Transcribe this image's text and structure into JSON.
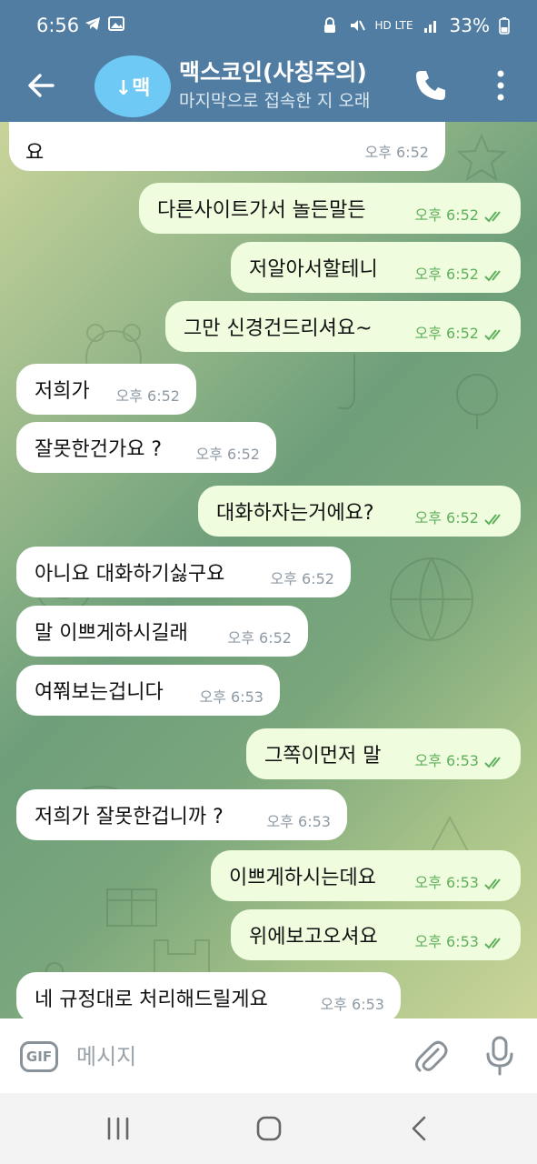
{
  "status_bar": {
    "time": "6:56",
    "network": "HD LTE",
    "battery": "33%"
  },
  "header": {
    "avatar_text": "↓맥",
    "title": "맥스코인(사칭주의)",
    "subtitle": "마지막으로 접속한 지 오래"
  },
  "messages": [
    {
      "dir": "in",
      "text": "요",
      "time": "오후 6:52"
    },
    {
      "dir": "out",
      "text": "다른사이트가서 놀든말든",
      "time": "오후 6:52"
    },
    {
      "dir": "out",
      "text": "저알아서할테니",
      "time": "오후 6:52"
    },
    {
      "dir": "out",
      "text": "그만 신경건드리셔요~",
      "time": "오후 6:52"
    },
    {
      "dir": "in",
      "text": "저희가",
      "time": "오후 6:52"
    },
    {
      "dir": "in",
      "text": "잘못한건가요 ?",
      "time": "오후 6:52"
    },
    {
      "dir": "out",
      "text": "대화하자는거에요?",
      "time": "오후 6:52"
    },
    {
      "dir": "in",
      "text": "아니요 대화하기싫구요",
      "time": "오후 6:52"
    },
    {
      "dir": "in",
      "text": "말 이쁘게하시길래",
      "time": "오후 6:52"
    },
    {
      "dir": "in",
      "text": "여쭤보는겁니다",
      "time": "오후 6:53"
    },
    {
      "dir": "out",
      "text": "그쪽이먼저 말",
      "time": "오후 6:53"
    },
    {
      "dir": "in",
      "text": "저희가 잘못한겁니까 ?",
      "time": "오후 6:53"
    },
    {
      "dir": "out",
      "text": "이쁘게하시는데요",
      "time": "오후 6:53"
    },
    {
      "dir": "out",
      "text": "위에보고오셔요",
      "time": "오후 6:53"
    },
    {
      "dir": "in",
      "text": "네 규정대로 처리해드릴게요",
      "time": "오후 6:53"
    }
  ],
  "composer": {
    "gif_label": "GIF",
    "placeholder": "메시지"
  },
  "colors": {
    "header": "#517da2",
    "incoming_bubble": "#ffffff",
    "outgoing_bubble": "#effdde",
    "outgoing_time": "#5fb05c"
  },
  "icons": [
    "back-arrow-icon",
    "phone-icon",
    "more-vertical-icon",
    "gif-icon",
    "paperclip-icon",
    "microphone-icon",
    "recents-icon",
    "home-icon",
    "nav-back-icon"
  ]
}
